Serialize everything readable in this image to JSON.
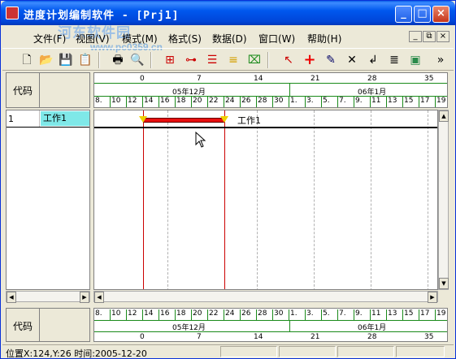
{
  "window": {
    "title": "进度计划编制软件 - [Prj1]",
    "watermark": "河东软件园",
    "watermark_url": "www.pc0359.cn"
  },
  "menu": [
    "文件(F)",
    "视图(V)",
    "模式(M)",
    "格式(S)",
    "数据(D)",
    "窗口(W)",
    "帮助(H)"
  ],
  "mdi_controls": [
    "_",
    "ð",
    "×"
  ],
  "toolbar": {
    "tools": [
      "new-file-icon",
      "open-folder-icon",
      "save-icon",
      "properties-icon",
      "print-icon",
      "print-preview-icon",
      "network-diagram-icon",
      "link-icon",
      "bar-chart-icon",
      "level-icon",
      "zoom-fit-icon",
      "pointer-icon",
      "add-icon",
      "chart-edit-icon",
      "delete-icon",
      "split-icon",
      "list-icon",
      "resource-icon"
    ],
    "overflow": "»"
  },
  "header": {
    "code_label": "代码"
  },
  "ruler": {
    "week_numbers": [
      "0",
      "7",
      "14",
      "21",
      "28",
      "35"
    ],
    "months": [
      "05年12月",
      "06年1月"
    ],
    "days": [
      "8.",
      "10",
      "12",
      "14",
      "16",
      "18",
      "20",
      "22",
      "24",
      "26",
      "28",
      "30",
      "1.",
      "3.",
      "5.",
      "7.",
      "9.",
      "11",
      "13",
      "15",
      "17",
      "19"
    ]
  },
  "tasks": [
    {
      "id": "1",
      "name": "工作1",
      "label": "工作1"
    }
  ],
  "status": {
    "text": "位置X:124,Y:26 时间:2005-12-20"
  },
  "colors": {
    "titlebar": "#0058ee",
    "bar": "#e81010",
    "milestone": "#f0d000",
    "ruler_grid": "#1a8a1a",
    "task_highlight": "#7fe8e8"
  }
}
